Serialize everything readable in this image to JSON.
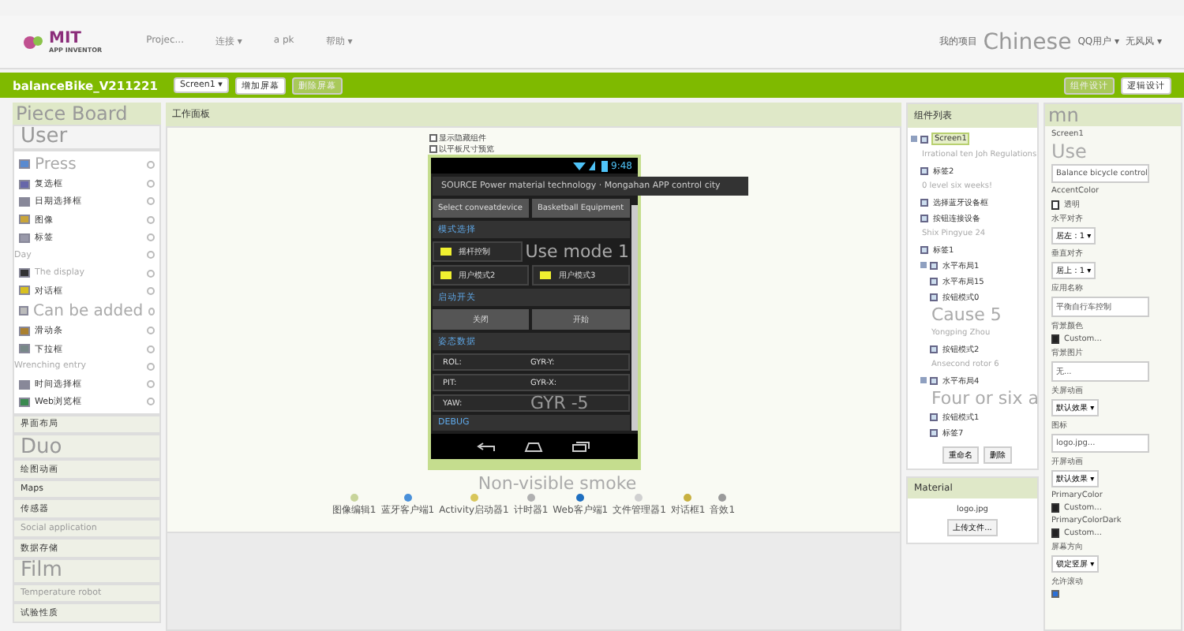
{
  "topbar": {
    "logo_title": "MIT",
    "logo_subtitle": "APP INVENTOR",
    "menus": [
      "Projec...",
      "连接 ▾",
      "a pk",
      "帮助 ▾"
    ],
    "links": [
      {
        "label": "我的项目",
        "kind": "small"
      },
      {
        "label": "Chinese",
        "kind": "large"
      },
      {
        "label": "QQ用户 ▾",
        "kind": "small"
      },
      {
        "label": "无风风 ▾",
        "kind": "small"
      }
    ]
  },
  "projectbar": {
    "title": "balanceBike_V211221",
    "screen": "Screen1 ▾",
    "buttons": [
      {
        "label": "增加屏幕",
        "disabled": false
      },
      {
        "label": "删除屏幕",
        "disabled": true
      }
    ],
    "modes": [
      {
        "label": "组件设计",
        "selected": true
      },
      {
        "label": "逻辑设计",
        "selected": false
      }
    ]
  },
  "palette": {
    "title": "Piece Board",
    "category": "User",
    "items": [
      {
        "label": "Press",
        "kind": "large"
      },
      {
        "label": "复选框",
        "kind": "item"
      },
      {
        "label": "日期选择框",
        "kind": "item"
      },
      {
        "label": "图像",
        "kind": "item"
      },
      {
        "label": "标签",
        "kind": "item"
      },
      {
        "label": "Day",
        "kind": "note"
      },
      {
        "label": "The display",
        "kind": "faded"
      },
      {
        "label": "对话框",
        "kind": "item"
      },
      {
        "label": "Can be added",
        "kind": "large"
      },
      {
        "label": "滑动条",
        "kind": "item"
      },
      {
        "label": "下拉框",
        "kind": "item"
      },
      {
        "label": "Wrenching entry",
        "kind": "note"
      },
      {
        "label": "时间选择框",
        "kind": "item"
      },
      {
        "label": "Web浏览框",
        "kind": "item"
      }
    ],
    "categories": [
      {
        "label": "界面布局",
        "kind": "item"
      },
      {
        "label": "Duo",
        "kind": "large"
      },
      {
        "label": "绘图动画",
        "kind": "item"
      },
      {
        "label": "Maps",
        "kind": "item"
      },
      {
        "label": "传感器",
        "kind": "item"
      },
      {
        "label": "Social application",
        "kind": "note"
      },
      {
        "label": "数据存储",
        "kind": "item"
      },
      {
        "label": "Film",
        "kind": "large"
      },
      {
        "label": "Temperature robot",
        "kind": "note"
      },
      {
        "label": "试验性质",
        "kind": "item"
      }
    ]
  },
  "viewer": {
    "title": "工作面板",
    "options": [
      {
        "label": "显示隐藏组件",
        "checked": false
      },
      {
        "label": "以平板尺寸预览",
        "checked": false
      }
    ],
    "phone": {
      "time": "9:48",
      "app_title": "SOURCE Power material technology · Mongahan APP control city",
      "connect_buttons": [
        "Select conveatdevice",
        "Basketball Equipment"
      ],
      "sections": [
        {
          "title": "模式选择",
          "kind": "modes",
          "buttons": [
            {
              "label": "摇杆控制",
              "kind": "button"
            },
            {
              "label": "Use mode 1",
              "kind": "overlay"
            },
            {
              "label": "用户模式2",
              "kind": "button"
            },
            {
              "label": "用户模式3",
              "kind": "button"
            }
          ]
        },
        {
          "title": "启动开关",
          "kind": "switch",
          "buttons": [
            "关闭",
            "开始"
          ]
        },
        {
          "title": "姿态数据",
          "kind": "data",
          "rows": [
            {
              "left": "ROL:",
              "right": "GYR-Y:"
            },
            {
              "left": "PIT:",
              "right": "GYR-X:"
            },
            {
              "left": "YAW:",
              "overlay": "GYR -5"
            }
          ]
        },
        {
          "title": "DEBUG",
          "kind": "cut"
        }
      ]
    },
    "nonvisible_title": "Non-visible smoke",
    "nonvisible": [
      {
        "label": "图像编辑1",
        "color": "#c8d49a"
      },
      {
        "label": "蓝牙客户端1",
        "color": "#4a90d9"
      },
      {
        "label": "Activity启动器1",
        "color": "#d8c65a"
      },
      {
        "label": "计时器1",
        "color": "#b0b0b0"
      },
      {
        "label": "Web客户端1",
        "color": "#1f6fc0"
      },
      {
        "label": "文件管理器1",
        "color": "#d0d0d0"
      },
      {
        "label": "对话框1",
        "color": "#c8b040"
      },
      {
        "label": "音效1",
        "color": "#9a9a9a"
      }
    ]
  },
  "components": {
    "title": "组件列表",
    "tree": [
      {
        "label": "Screen1",
        "kind": "node",
        "selected": true,
        "expanded": true,
        "children": [
          {
            "label": "Irrational ten Joh Regulations",
            "kind": "note"
          },
          {
            "label": "标签2",
            "kind": "node",
            "selected": false
          },
          {
            "label": "0 level six weeks!",
            "kind": "note"
          },
          {
            "label": "选择蓝牙设备框",
            "kind": "node",
            "selected": false
          },
          {
            "label": "按钮连接设备",
            "kind": "node",
            "selected": false
          },
          {
            "label": "Shix Pingyue 24",
            "kind": "note"
          },
          {
            "label": "标签1",
            "kind": "node",
            "selected": false
          },
          {
            "label": "水平布局1",
            "kind": "node",
            "selected": false,
            "expanded": true,
            "children": [
              {
                "label": "水平布局15",
                "kind": "node",
                "selected": false
              },
              {
                "label": "按钮模式0",
                "kind": "node",
                "selected": false
              },
              {
                "label": "Cause 5",
                "kind": "large"
              },
              {
                "label": "Yongping Zhou",
                "kind": "note"
              },
              {
                "label": "按钮模式2",
                "kind": "node",
                "selected": false
              },
              {
                "label": "Ansecond rotor 6",
                "kind": "note"
              }
            ]
          },
          {
            "label": "水平布局4",
            "kind": "node",
            "selected": false,
            "expanded": true,
            "children": [
              {
                "label": "Four or six a",
                "kind": "large"
              },
              {
                "label": "按钮模式1",
                "kind": "node",
                "selected": false
              },
              {
                "label": "标签7",
                "kind": "node",
                "selected": false
              }
            ]
          }
        ]
      }
    ],
    "buttons": [
      "重命名",
      "删除"
    ],
    "media_title": "Material",
    "media_files": [
      "logo.jpg"
    ],
    "upload": "上传文件..."
  },
  "properties": {
    "title": "mn",
    "component": "Screen1",
    "items": [
      {
        "kind": "large",
        "label": "Use"
      },
      {
        "kind": "field",
        "value": "Balance bicycle control"
      },
      {
        "kind": "label",
        "label": "AccentColor"
      },
      {
        "kind": "swatch",
        "value": "透明",
        "color": "#ffffff"
      },
      {
        "kind": "label",
        "label": "水平对齐"
      },
      {
        "kind": "dropdown",
        "value": "居左 : 1 ▾"
      },
      {
        "kind": "label",
        "label": "垂直对齐"
      },
      {
        "kind": "dropdown",
        "value": "居上 : 1 ▾"
      },
      {
        "kind": "label",
        "label": "应用名称"
      },
      {
        "kind": "field",
        "value": "平衡自行车控制"
      },
      {
        "kind": "label",
        "label": "背景颜色"
      },
      {
        "kind": "swatch",
        "value": "Custom...",
        "color": "#222222"
      },
      {
        "kind": "label",
        "label": "背景图片"
      },
      {
        "kind": "field",
        "value": "无..."
      },
      {
        "kind": "label",
        "label": "关屏动画"
      },
      {
        "kind": "dropdown",
        "value": "默认效果 ▾"
      },
      {
        "kind": "label",
        "label": "图标"
      },
      {
        "kind": "field",
        "value": "logo.jpg..."
      },
      {
        "kind": "label",
        "label": "开屏动画"
      },
      {
        "kind": "dropdown",
        "value": "默认效果 ▾"
      },
      {
        "kind": "label",
        "label": "PrimaryColor"
      },
      {
        "kind": "swatch",
        "value": "Custom...",
        "color": "#222222"
      },
      {
        "kind": "label",
        "label": "PrimaryColorDark"
      },
      {
        "kind": "swatch",
        "value": "Custom...",
        "color": "#222222"
      },
      {
        "kind": "label",
        "label": "屏幕方向"
      },
      {
        "kind": "dropdown",
        "value": "锁定竖屏 ▾"
      },
      {
        "kind": "label",
        "label": "允许滚动"
      },
      {
        "kind": "checkbox",
        "checked": true
      }
    ]
  }
}
